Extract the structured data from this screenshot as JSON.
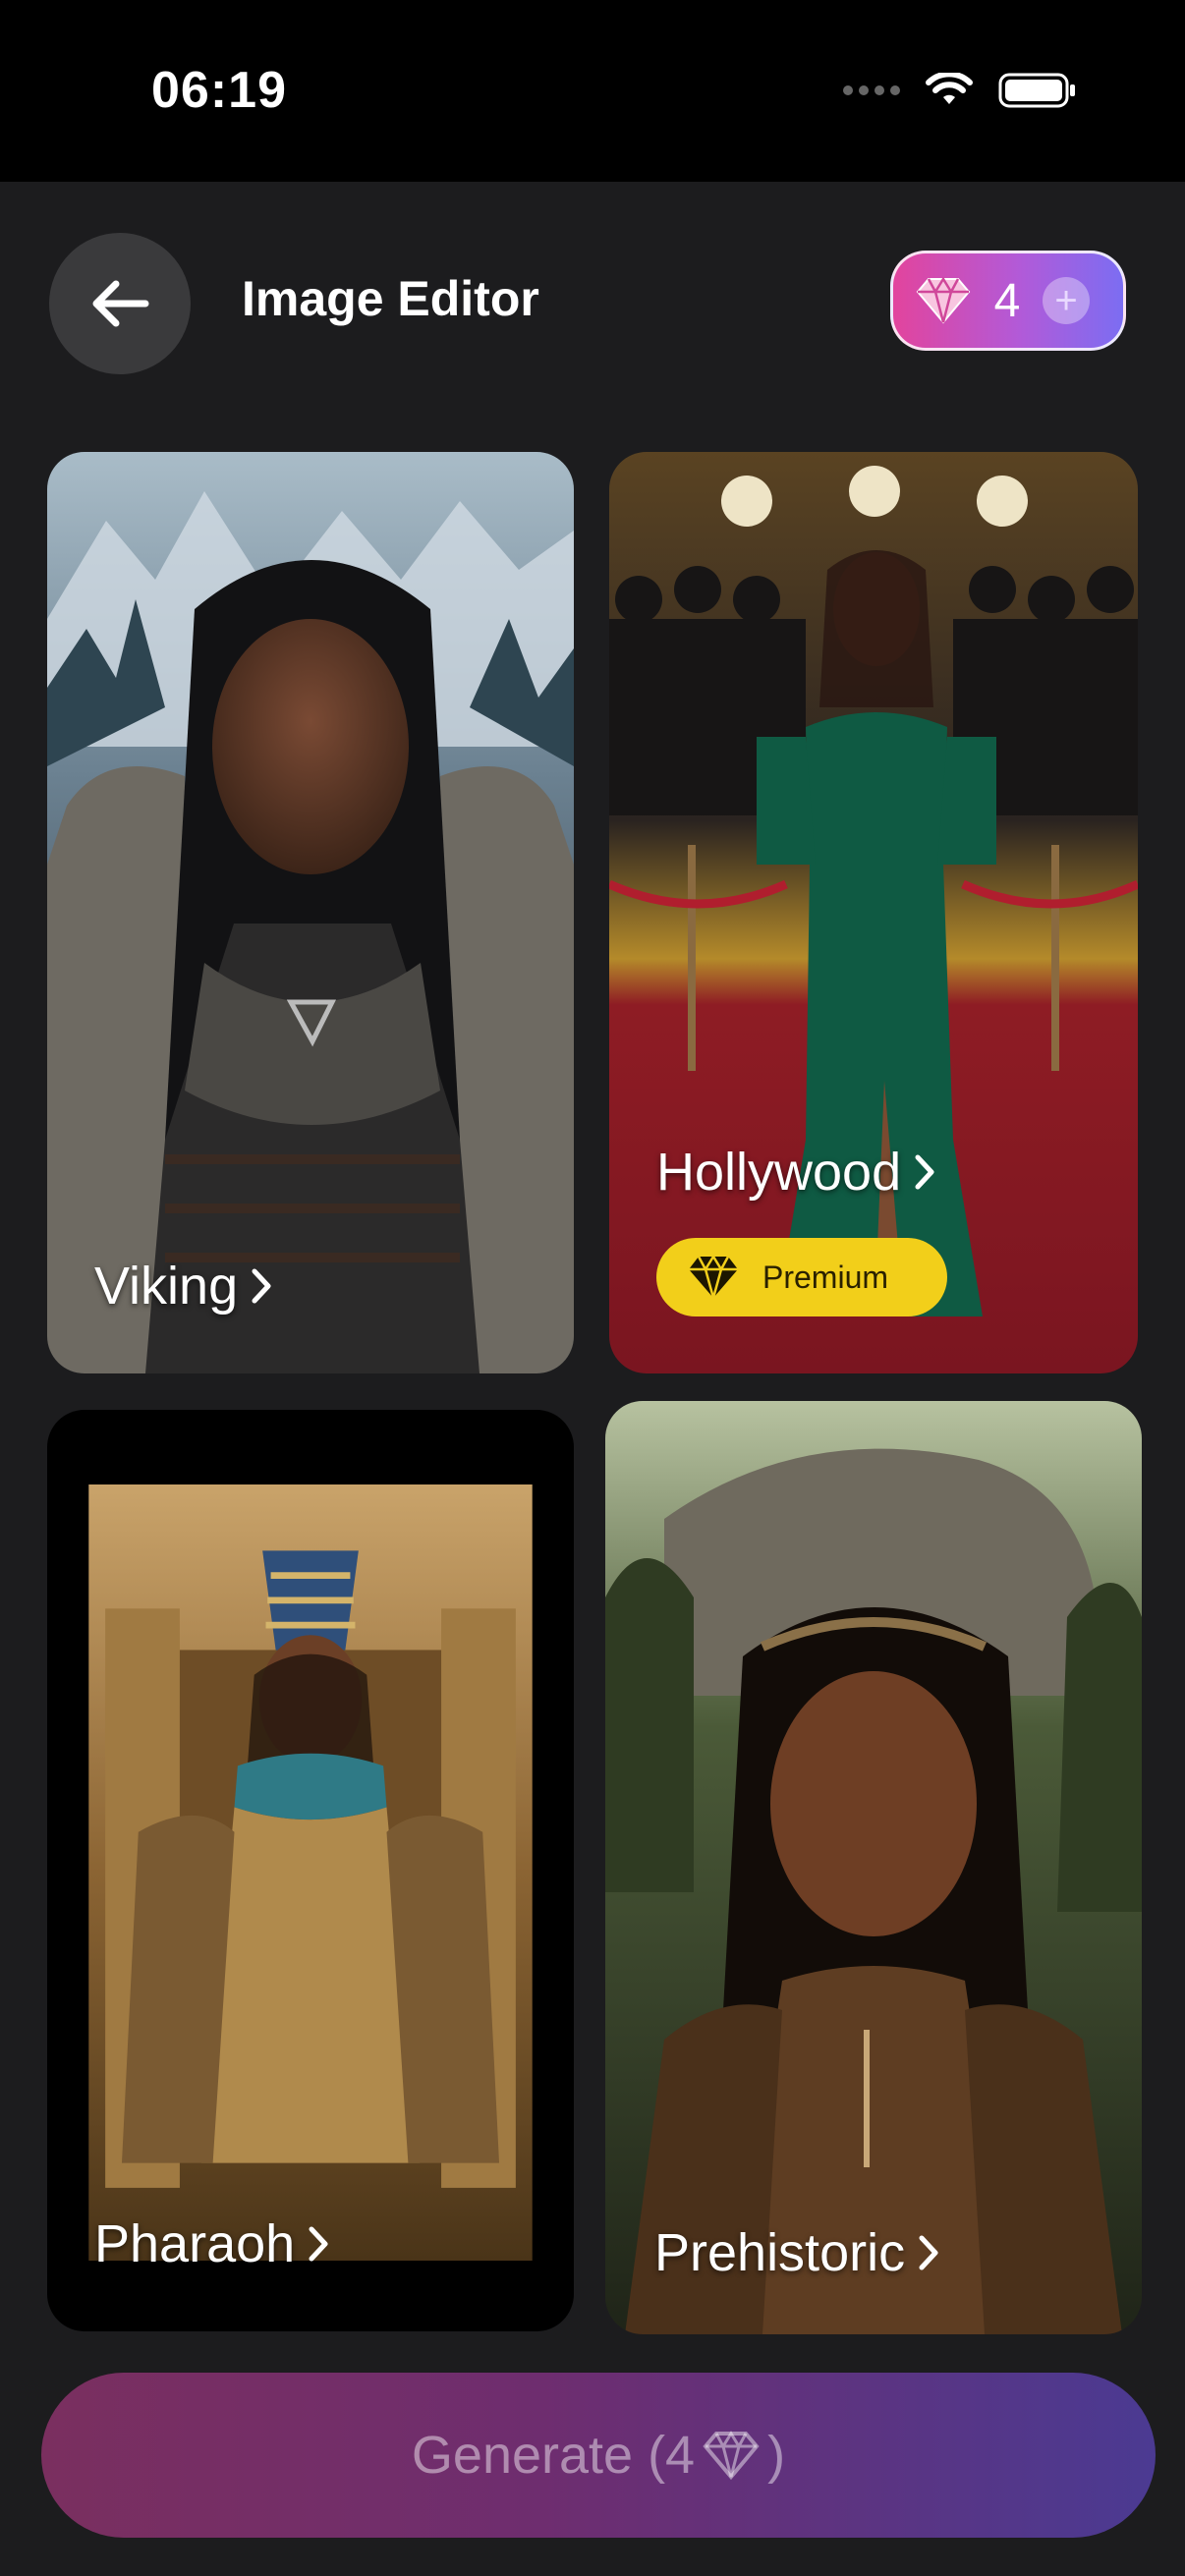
{
  "status_bar": {
    "time": "06:19"
  },
  "header": {
    "title": "Image Editor",
    "credits": "4"
  },
  "cards": [
    {
      "label": "Viking"
    },
    {
      "label": "Hollywood",
      "badge": "Premium"
    },
    {
      "label": "Pharaoh"
    },
    {
      "label": "Prehistoric"
    }
  ],
  "generate": {
    "label": "Generate (4",
    "label_end": ")"
  },
  "colors": {
    "background": "#1c1c1e",
    "premium_badge": "#f2cf1a",
    "credits_gradient_start": "#e2449d",
    "credits_gradient_end": "#7c6df2",
    "generate_gradient_start": "#7a2f5f",
    "generate_gradient_end": "#4b3a92"
  },
  "icons": [
    "back-arrow-icon",
    "diamond-icon",
    "plus-icon",
    "chevron-right-icon",
    "wifi-icon",
    "battery-icon",
    "signal-icon"
  ]
}
